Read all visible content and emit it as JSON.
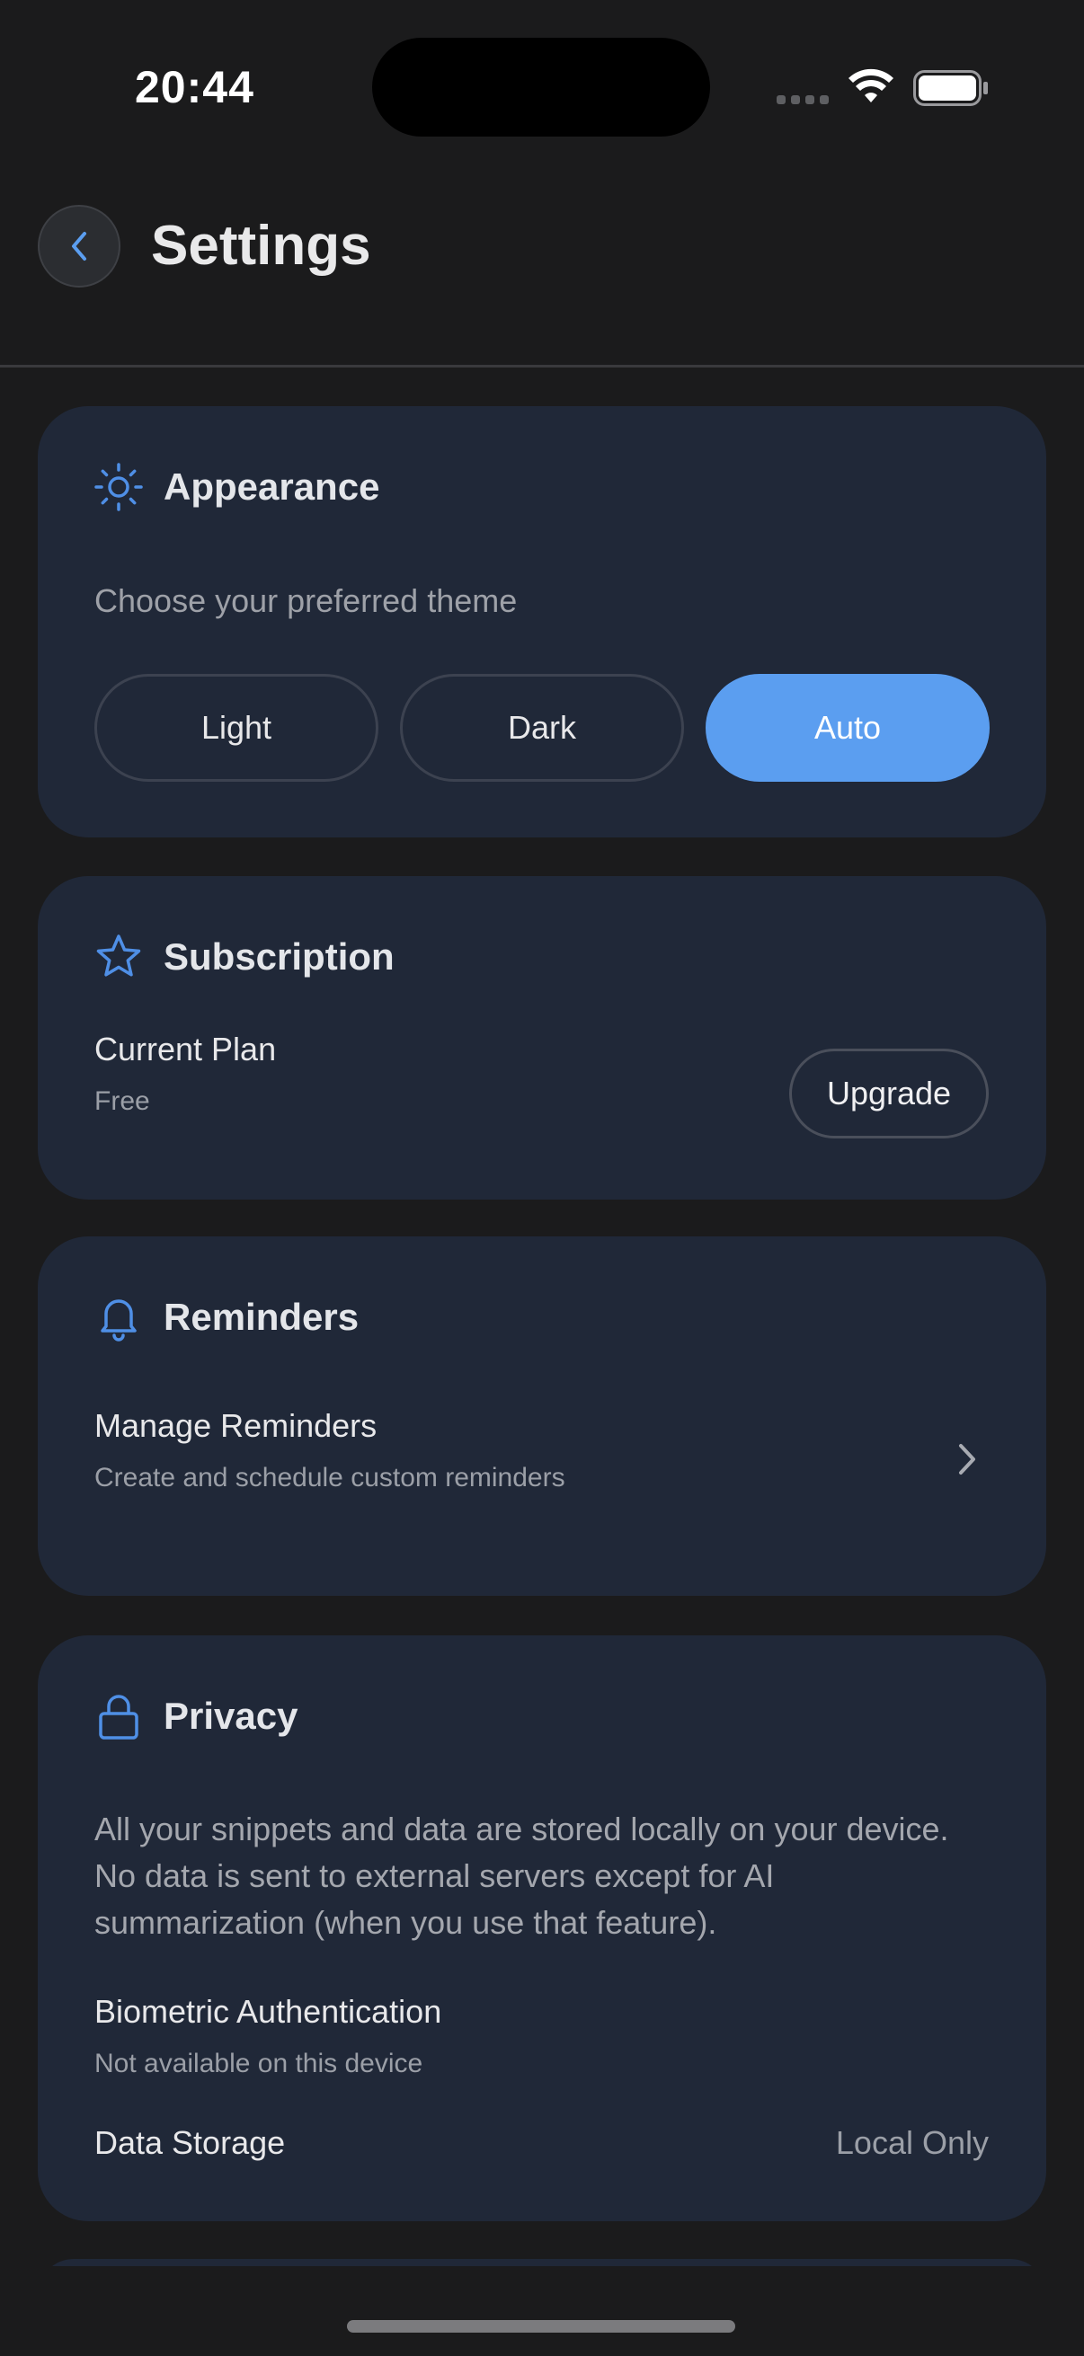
{
  "status_bar": {
    "time": "20:44"
  },
  "header": {
    "title": "Settings"
  },
  "appearance": {
    "title": "Appearance",
    "description": "Choose your preferred theme",
    "options": [
      "Light",
      "Dark",
      "Auto"
    ],
    "selected": "Auto"
  },
  "subscription": {
    "title": "Subscription",
    "plan_label": "Current Plan",
    "plan_value": "Free",
    "upgrade_label": "Upgrade"
  },
  "reminders": {
    "title": "Reminders",
    "manage_title": "Manage Reminders",
    "manage_subtitle": "Create and schedule custom reminders"
  },
  "privacy": {
    "title": "Privacy",
    "description": "All your snippets and data are stored locally on your device. No data is sent to external servers except for AI summarization (when you use that feature).",
    "biometric_label": "Biometric Authentication",
    "biometric_value": "Not available on this device",
    "storage_label": "Data Storage",
    "storage_value": "Local Only"
  },
  "colors": {
    "background": "#1b1b1c",
    "card": "#202838",
    "accent": "#5b9ef0",
    "icon": "#4f8fe6"
  },
  "icons": {
    "back": "chevron-left-icon",
    "appearance": "sun-icon",
    "subscription": "star-icon",
    "reminders": "bell-icon",
    "privacy": "lock-icon",
    "row_chevron": "chevron-right-icon"
  }
}
